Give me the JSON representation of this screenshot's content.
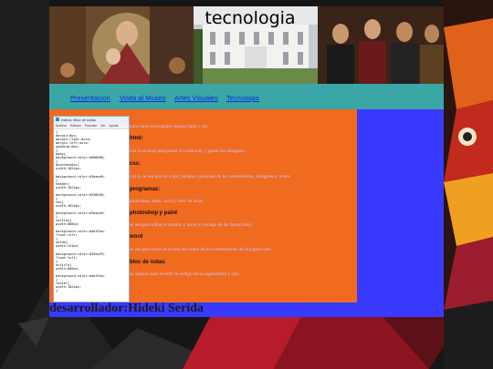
{
  "site": {
    "title": "tecnologia",
    "nav": [
      "Presentacion",
      "Visita al Museo",
      "Artes Visuales",
      "Tecnologia"
    ],
    "footer": "desarrollador:Hideki Serida"
  },
  "notepad": {
    "title": "estilos: Bloc de notas",
    "menu": [
      "Archivo",
      "Edicion",
      "Formato",
      "Ver",
      "Ayuda"
    ],
    "code": "{\nmargin:0px;\nmargin-right:auto;\nmargin-left:auto;\npadding:0px;\n}\nbody{\nbackground-color:#000000;\n}\n#contenedor{\nwidth:1024px;\n\nbackground-color:#3eaaa9;\n}\nheader{\nwidth:1024px;\n\nbackground-color:#536b50;\n}\nnav{\nwidth:1024px;\n\nbackground-color:#3eaaa9;\n}\nsection{\nwidth:800px;\n\nbackground-color:#ad194a;\nfloat:left;\n}\naside{\nwidth:224px;\n\nbackground-color:#33ea29;\nfloat:left;\n}\narticle{\nwidth:800px;\n\nbackground-color:#ad194a;\n}\nfooter{\nwidth:1024px;\n}"
  },
  "content": {
    "intro": "para hacer esta pagina usamos html y css",
    "sections": [
      {
        "heading": "html:",
        "text": "con la usamos para poner el contenido, y poner las imagenes"
      },
      {
        "heading": "css:",
        "text": "con la se usa para el color, tamaño y posicion de los contenedores, imagenes y textos"
      },
      {
        "heading": "programas:",
        "text": "photoshop, atom, word y bloc de notas"
      },
      {
        "heading": "photoshop y paint",
        "text": "se usa para editar el tamaño y hacer el collage de las fotos(fotos)"
      },
      {
        "heading": "word",
        "text": "se usa para hacer el boceto del orden de los contenedores de la pagina web"
      },
      {
        "heading": "bloc de notas",
        "text": "se usamos para escribir le codigo de la pagina(html y css)"
      }
    ]
  },
  "colors": {
    "nav": "#3aa6a6",
    "article": "#f06a20",
    "container": "#3a3aff",
    "link": "#0a2fd6"
  }
}
